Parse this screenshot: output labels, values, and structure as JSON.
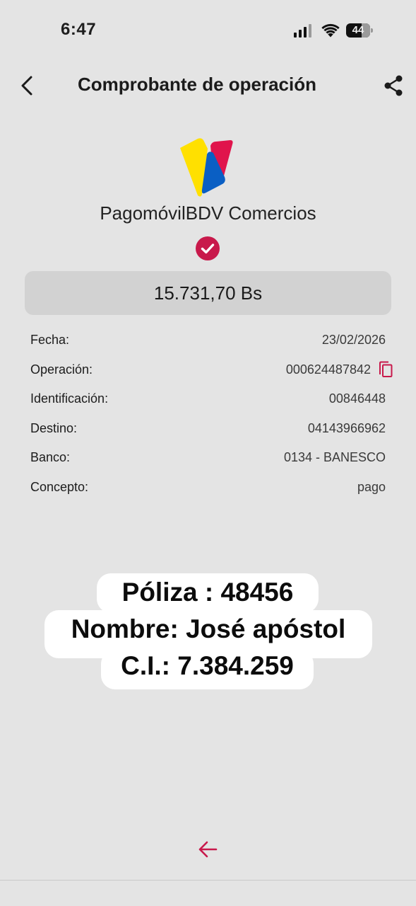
{
  "status_bar": {
    "time": "6:47",
    "battery": "44"
  },
  "header": {
    "title": "Comprobante de operación",
    "back_icon": "chevron-left-icon",
    "share_icon": "share-icon"
  },
  "brand": {
    "name": "PagomóvilBDV Comercios",
    "colors": {
      "yellow": "#FFE000",
      "red": "#E0144C",
      "blue": "#0A5FC4"
    }
  },
  "status_icon": "check-circle-icon",
  "accent_color": "#C8194B",
  "amount": "15.731,70 Bs",
  "details": [
    {
      "label": "Fecha:",
      "value": "23/02/2026"
    },
    {
      "label": "Operación:",
      "value": "000624487842"
    },
    {
      "label": "Identificación:",
      "value": "00846448"
    },
    {
      "label": "Destino:",
      "value": "04143966962"
    },
    {
      "label": "Banco:",
      "value": "0134 - BANESCO"
    },
    {
      "label": "Concepto:",
      "value": "pago"
    }
  ],
  "overlay": {
    "line1": "Póliza : 48456",
    "line2": "Nombre: José apóstol",
    "line3": "C.I.: 7.384.259"
  },
  "bottom": {
    "back_icon": "arrow-left-icon"
  }
}
